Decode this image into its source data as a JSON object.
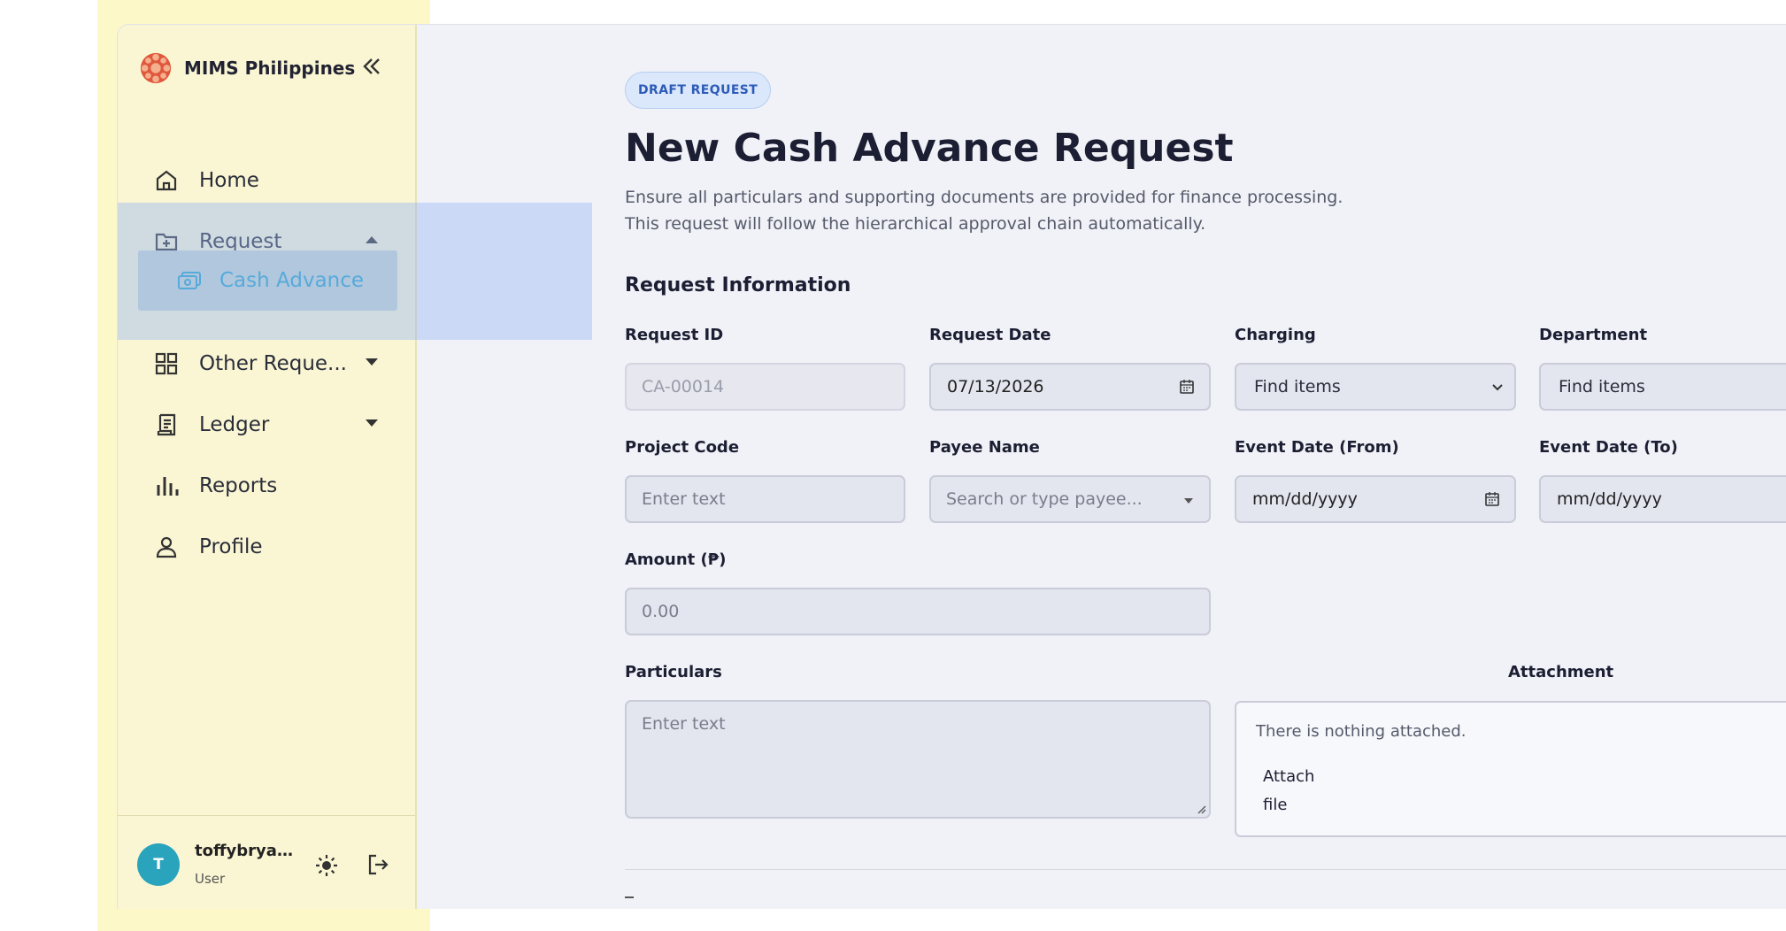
{
  "brand": {
    "name": "MIMS Philippines"
  },
  "sidebar": {
    "items": [
      {
        "label": "Home",
        "icon": "home-icon"
      },
      {
        "label": "Request",
        "icon": "folder-plus-icon",
        "expanded": true
      },
      {
        "label": "Other Reque...",
        "icon": "grid-icon"
      },
      {
        "label": "Ledger",
        "icon": "receipt-icon"
      },
      {
        "label": "Reports",
        "icon": "bar-chart-icon"
      },
      {
        "label": "Profile",
        "icon": "user-icon"
      }
    ],
    "subitems": [
      {
        "label": "Cash Advance",
        "icon": "cash-icon",
        "active": true
      }
    ]
  },
  "user": {
    "initial": "T",
    "name": "toffybryan...",
    "role": "User"
  },
  "header": {
    "badge": "DRAFT REQUEST",
    "title": "New Cash Advance Request",
    "desc_line1": "Ensure all particulars and supporting documents are provided for finance processing.",
    "desc_line2": "This request will follow the hierarchical approval chain automatically."
  },
  "form": {
    "section_title": "Request Information",
    "request_id": {
      "label": "Request ID",
      "value": "CA-00014"
    },
    "request_date": {
      "label": "Request Date",
      "value": "07/13/2026"
    },
    "charging": {
      "label": "Charging",
      "value": "Find items"
    },
    "department": {
      "label": "Department",
      "value": "Find items"
    },
    "project_code": {
      "label": "Project Code",
      "placeholder": "Enter text"
    },
    "payee_name": {
      "label": "Payee Name",
      "placeholder": "Search or type payee..."
    },
    "event_from": {
      "label": "Event Date (From)",
      "placeholder": "mm/dd/yyyy"
    },
    "event_to": {
      "label": "Event Date (To)",
      "placeholder": "mm/dd/yyyy"
    },
    "amount": {
      "label": "Amount (₱)",
      "placeholder": "0.00"
    },
    "particulars": {
      "label": "Particulars",
      "placeholder": "Enter text"
    },
    "attachment": {
      "label": "Attachment",
      "empty_text": "There is nothing attached.",
      "button_line1": "Attach",
      "button_line2": "file"
    }
  },
  "colors": {
    "accent": "#2aa2c6",
    "sidebar_bg": "#faf6d3",
    "badge_text": "#2d5bb8",
    "page_bg": "#f1f2f7"
  }
}
